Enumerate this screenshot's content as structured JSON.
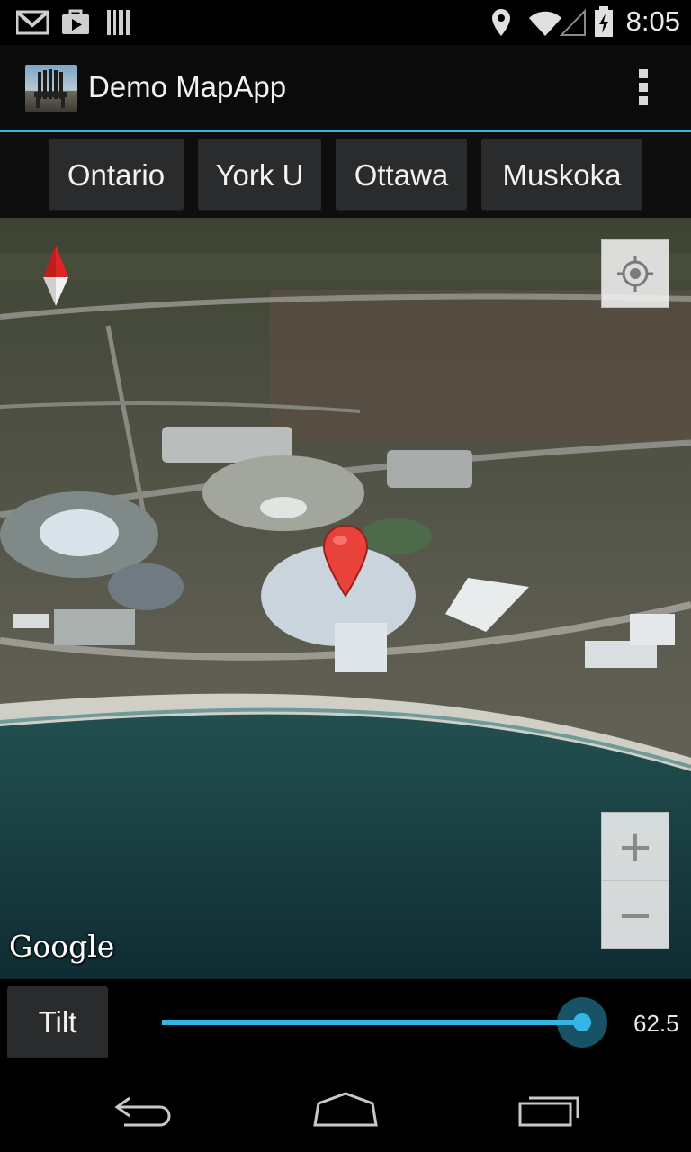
{
  "status_bar": {
    "time": "8:05",
    "icons": [
      "gmail-icon",
      "play-store-icon",
      "barcode-icon",
      "location-icon",
      "wifi-icon",
      "signal-icon",
      "battery-icon"
    ]
  },
  "action_bar": {
    "title": "Demo MapApp",
    "accent_color": "#33b5e5"
  },
  "location_buttons": [
    "Ontario",
    "York U",
    "Ottawa",
    "Muskoka"
  ],
  "map": {
    "attribution": "Google",
    "controls": [
      "compass-icon",
      "my-location-icon",
      "zoom-in-icon",
      "zoom-out-icon",
      "map-marker-icon"
    ],
    "zoom_in_label": "+",
    "zoom_out_label": "−"
  },
  "tilt": {
    "button_label": "Tilt",
    "value_label": "62.5",
    "slider_fraction": 0.96
  },
  "nav_bar": {
    "icons": [
      "back-icon",
      "home-icon",
      "recent-apps-icon"
    ]
  }
}
